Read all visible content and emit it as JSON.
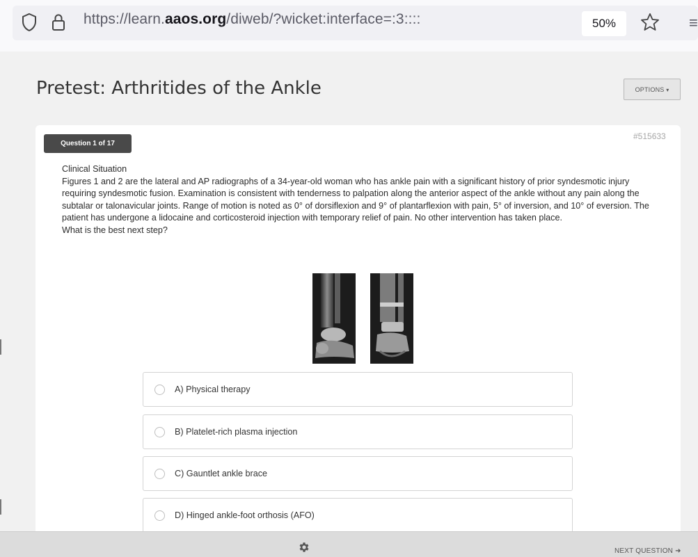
{
  "browser": {
    "url_prefix": "https://learn.",
    "url_domain": "aaos.org",
    "url_suffix": "/diweb/?wicket:interface=:3::::",
    "zoom": "50%",
    "icons": [
      "shield-icon",
      "lock-icon",
      "bookmark-star-icon",
      "menu-icon"
    ]
  },
  "page": {
    "title": "Pretest: Arthritides of the Ankle",
    "options_label": "OPTIONS",
    "options_caret": "▾"
  },
  "question": {
    "badge": "Question 1 of 17",
    "id": "#515633",
    "heading": "Clinical Situation",
    "body": "Figures 1 and 2 are the lateral and AP radiographs of a 34-year-old woman who has ankle pain with a significant history of prior syndesmotic injury requiring syndesmotic fusion. Examination is consistent with tenderness to palpation along the anterior aspect of the ankle without any pain along the subtalar or talonavicular joints. Range of motion is noted as 0° of dorsiflexion and 9° of plantarflexion with pain, 5° of inversion, and 10° of eversion. The patient has undergone a lidocaine and corticosteroid injection with temporary relief of pain. No other intervention has taken place.",
    "prompt": "What is the best next step?",
    "answers": [
      {
        "label": "A) Physical therapy"
      },
      {
        "label": "B) Platelet-rich plasma injection"
      },
      {
        "label": "C) Gauntlet ankle brace"
      },
      {
        "label": "D) Hinged ankle-foot orthosis (AFO)"
      }
    ]
  },
  "footer": {
    "next_label": "NEXT QUESTION",
    "next_arrow": "➜",
    "settings_icon": "gear-icon"
  },
  "colors": {
    "badge_bg": "#494949",
    "page_bg": "#f1f1f1",
    "footer_bg": "#dcdcdc"
  }
}
